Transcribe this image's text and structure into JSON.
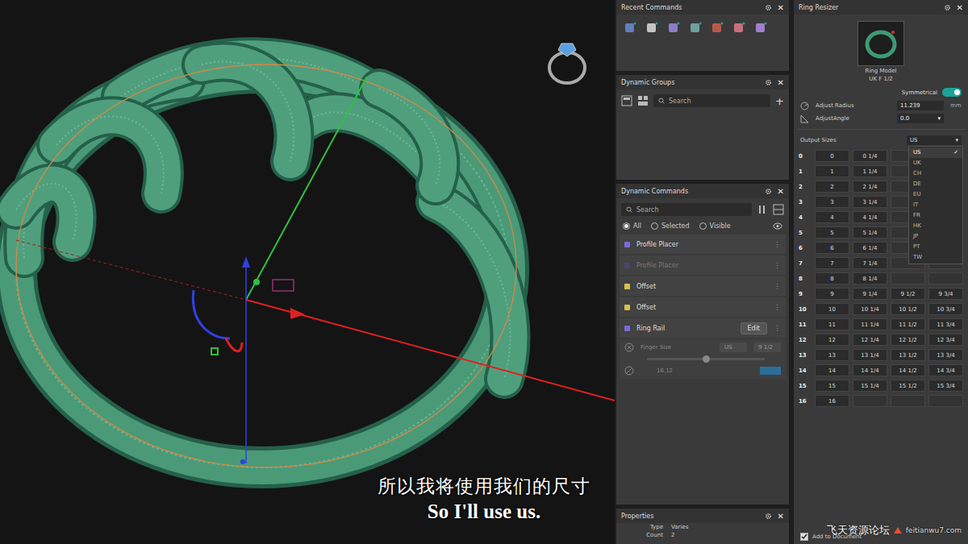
{
  "viewport": {
    "subtitle_zh": "所以我将使用我们的尺寸",
    "subtitle_en": "So I'll use us."
  },
  "close": "✕",
  "recent_commands": {
    "title": "Recent Commands"
  },
  "dynamic_groups": {
    "title": "Dynamic Groups",
    "search_placeholder": "Search",
    "add": "+"
  },
  "dynamic_commands": {
    "title": "Dynamic Commands",
    "search_placeholder": "Search",
    "filters": [
      {
        "label": "All",
        "selected": true
      },
      {
        "label": "Selected",
        "selected": false
      },
      {
        "label": "Visible",
        "selected": false
      }
    ],
    "menu": "⋮",
    "items": [
      {
        "label": "Profile Placer",
        "color": "#7b68d8",
        "disabled": false,
        "button": "",
        "expanded": false
      },
      {
        "label": "Profile Placer",
        "color": "#4b4470",
        "disabled": true,
        "button": "",
        "expanded": false
      },
      {
        "label": "Offset",
        "color": "#d8c24a",
        "disabled": false,
        "button": "",
        "expanded": false
      },
      {
        "label": "Offset",
        "color": "#d8c24a",
        "disabled": false,
        "button": "",
        "expanded": false
      },
      {
        "label": "Ring Rail",
        "color": "#7b68d8",
        "disabled": false,
        "button": "Edit",
        "expanded": true
      }
    ],
    "ring_rail": {
      "finger_label": "Finger Size",
      "standard": "US",
      "size": "9 1/2",
      "level": 0.5,
      "value": "16.12"
    }
  },
  "properties": {
    "title": "Properties",
    "rows": [
      {
        "key": "Type",
        "value": "Varies"
      },
      {
        "key": "Count",
        "value": "2"
      }
    ]
  },
  "ring_resizer": {
    "title": "Ring Resizer",
    "model_label": "Ring Model",
    "model_size": "UK F 1/2",
    "symmetrical": {
      "label": "Symmetrical",
      "on": true
    },
    "adjust_radius": {
      "label": "Adjust Radius",
      "value": "11.239",
      "unit": "mm"
    },
    "adjust_angle": {
      "label": "AdjustAngle",
      "value": "0.0",
      "arrow": "▾"
    },
    "output_sizes": {
      "label": "Output Sizes",
      "value": "US",
      "arrow": "▾",
      "open": true,
      "check": "✓",
      "options": [
        {
          "label": "US",
          "selected": true
        },
        {
          "label": "UK",
          "selected": false
        },
        {
          "label": "CH",
          "selected": false
        },
        {
          "label": "DE",
          "selected": false
        },
        {
          "label": "EU",
          "selected": false
        },
        {
          "label": "IT",
          "selected": false
        },
        {
          "label": "FR",
          "selected": false
        },
        {
          "label": "HK",
          "selected": false
        },
        {
          "label": "JP",
          "selected": false
        },
        {
          "label": "PT",
          "selected": false
        },
        {
          "label": "TW",
          "selected": false
        }
      ]
    },
    "rows": [
      {
        "label": "0",
        "cells": [
          "0",
          "0 1/4"
        ]
      },
      {
        "label": "1",
        "cells": [
          "1",
          "1 1/4"
        ]
      },
      {
        "label": "2",
        "cells": [
          "2",
          "2 1/4"
        ]
      },
      {
        "label": "3",
        "cells": [
          "3",
          "3 1/4"
        ]
      },
      {
        "label": "4",
        "cells": [
          "4",
          "4 1/4"
        ]
      },
      {
        "label": "5",
        "cells": [
          "5",
          "5 1/4"
        ]
      },
      {
        "label": "6",
        "cells": [
          "6",
          "6 1/4"
        ]
      },
      {
        "label": "7",
        "cells": [
          "7",
          "7 1/4"
        ]
      },
      {
        "label": "8",
        "cells": [
          "8",
          "8 1/4"
        ]
      },
      {
        "label": "9",
        "cells": [
          "9",
          "9 1/4",
          "9 1/2",
          "9 3/4"
        ]
      },
      {
        "label": "10",
        "cells": [
          "10",
          "10 1/4",
          "10 1/2",
          "10 3/4"
        ]
      },
      {
        "label": "11",
        "cells": [
          "11",
          "11 1/4",
          "11 1/2",
          "11 3/4"
        ]
      },
      {
        "label": "12",
        "cells": [
          "12",
          "12 1/4",
          "12 1/2",
          "12 3/4"
        ]
      },
      {
        "label": "13",
        "cells": [
          "13",
          "13 1/4",
          "13 1/2",
          "13 3/4"
        ]
      },
      {
        "label": "14",
        "cells": [
          "14",
          "14 1/4",
          "14 1/2",
          "14 3/4"
        ]
      },
      {
        "label": "15",
        "cells": [
          "15",
          "15 1/4",
          "15 1/2",
          "15 3/4"
        ]
      },
      {
        "label": "16",
        "cells": [
          "16"
        ]
      }
    ],
    "add_to_document": {
      "label": "Add to Document",
      "checked": true
    }
  },
  "watermark": {
    "text": "飞天资源论坛",
    "url": "feitianwu7.com"
  }
}
